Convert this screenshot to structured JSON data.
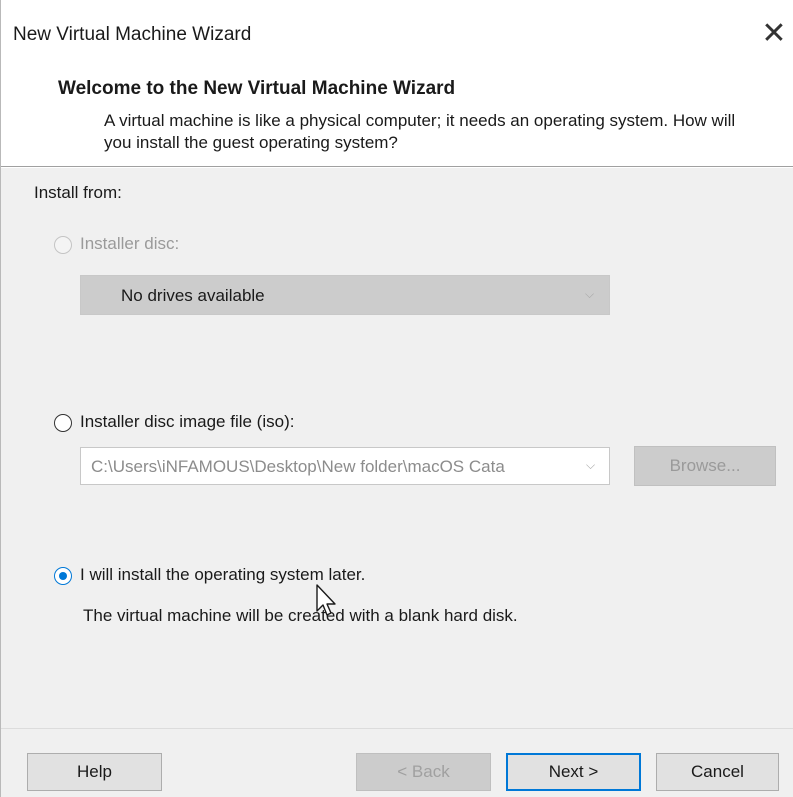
{
  "window": {
    "title": "New Virtual Machine Wizard",
    "close_glyph": "✕"
  },
  "header": {
    "title": "Welcome to the New Virtual Machine Wizard",
    "description": "A virtual machine is like a physical computer; it needs an operating system. How will you install the guest operating system?"
  },
  "install": {
    "label": "Install from:",
    "options": [
      {
        "label": "Installer disc:",
        "selected": false,
        "enabled": false,
        "combo_value": "No drives available"
      },
      {
        "label": "Installer disc image file (iso):",
        "selected": false,
        "enabled": true,
        "combo_value": "C:\\Users\\iNFAMOUS\\Desktop\\New folder\\macOS Cata",
        "browse_label": "Browse..."
      },
      {
        "label": "I will install the operating system later.",
        "selected": true,
        "enabled": true,
        "description": "The virtual machine will be created with a blank hard disk."
      }
    ]
  },
  "footer": {
    "help_label": "Help",
    "back_label": "< Back",
    "next_label": "Next >",
    "cancel_label": "Cancel"
  },
  "colors": {
    "accent": "#0078d7",
    "panel_bg": "#f0f0f0",
    "disabled_bg": "#cccccc"
  }
}
